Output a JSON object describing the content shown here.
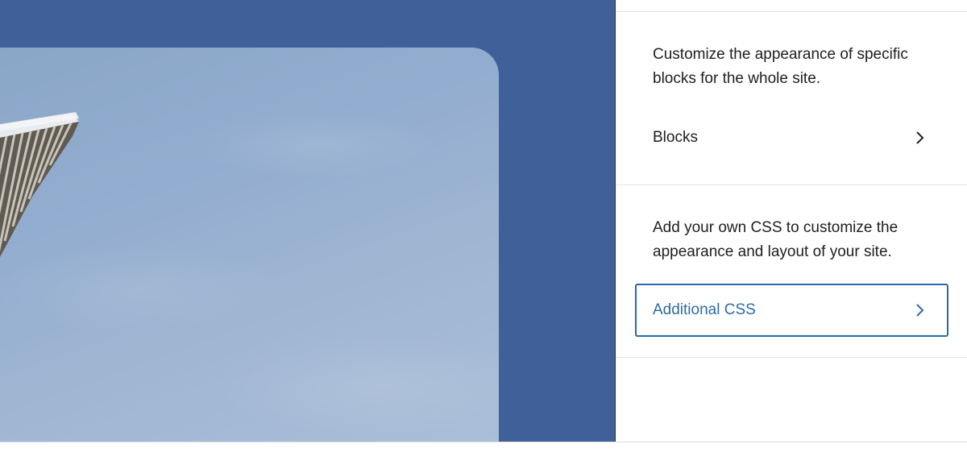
{
  "colors": {
    "canvas_background": "#40609a",
    "focus_accent": "#2d6aa3",
    "text": "#1e1e1e"
  },
  "preview": {
    "image": "sky-photo-with-building-overhang"
  },
  "sidebar": {
    "blocks_section": {
      "description": "Customize the appearance of specific blocks for the whole site.",
      "item_label": "Blocks",
      "item_icon": "chevron-right-icon"
    },
    "css_section": {
      "description": "Add your own CSS to customize the appearance and layout of your site.",
      "item_label": "Additional CSS",
      "item_icon": "chevron-right-icon",
      "focused": true
    }
  }
}
